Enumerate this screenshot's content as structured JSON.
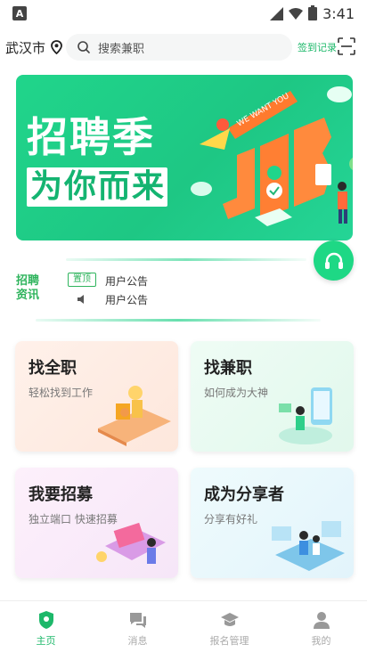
{
  "status_bar": {
    "time": "3:41"
  },
  "header": {
    "city": "武汉市",
    "search_placeholder": "搜索兼职",
    "signin_label": "签到记录"
  },
  "banner": {
    "title_line1": "招聘季",
    "title_line2": "为你而来",
    "art_text": "WE WANT YOU"
  },
  "announcement": {
    "logo_text": "招聘资讯",
    "pin_badge": "置顶",
    "items": [
      "用户公告",
      "用户公告"
    ]
  },
  "cards": [
    {
      "title": "找全职",
      "subtitle": "轻松找到工作"
    },
    {
      "title": "找兼职",
      "subtitle": "如何成为大神"
    },
    {
      "title": "我要招募",
      "subtitle": "独立端口 快速招募"
    },
    {
      "title": "成为分享者",
      "subtitle": "分享有好礼"
    }
  ],
  "bottom_nav": [
    {
      "label": "主页",
      "active": true
    },
    {
      "label": "消息",
      "active": false
    },
    {
      "label": "报名管理",
      "active": false
    },
    {
      "label": "我的",
      "active": false
    }
  ],
  "colors": {
    "brand_green": "#1db86a",
    "banner_green": "#20d58b"
  }
}
